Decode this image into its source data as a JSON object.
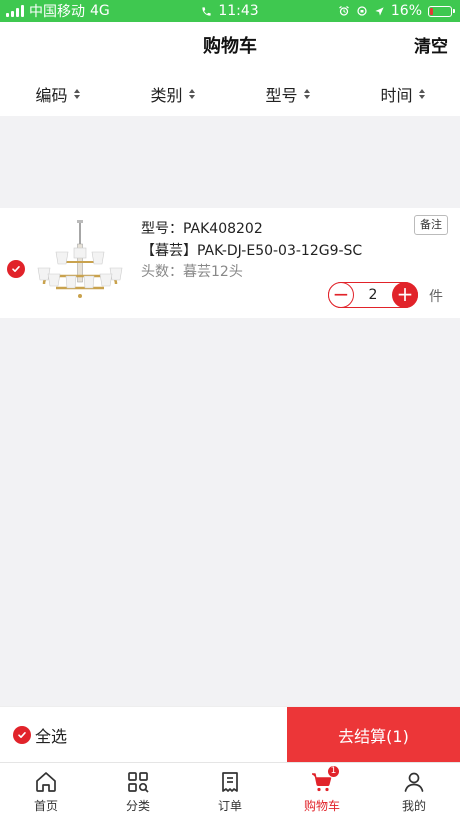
{
  "status_bar": {
    "carrier": "中国移动",
    "network": "4G",
    "time": "11:43",
    "battery": "16%",
    "battery_level": 0.16
  },
  "nav": {
    "title": "购物车",
    "clear_label": "清空"
  },
  "sort_bar": {
    "items": [
      {
        "label": "编码"
      },
      {
        "label": "类别"
      },
      {
        "label": "型号"
      },
      {
        "label": "时间"
      }
    ]
  },
  "cart": {
    "items": [
      {
        "model": "型号：PAK408202",
        "name": "【暮芸】PAK-DJ-E50-03-12G9-SC",
        "heads": "头数：暮芸12头",
        "note_label": "备注",
        "quantity": "2",
        "unit": "件",
        "checked": true
      }
    ]
  },
  "checkout": {
    "select_all_label": "全选",
    "button_label": "去结算(1)"
  },
  "tab_bar": {
    "tabs": [
      {
        "label": "首页",
        "icon": "home-icon"
      },
      {
        "label": "分类",
        "icon": "category-icon"
      },
      {
        "label": "订单",
        "icon": "order-icon"
      },
      {
        "label": "购物车",
        "icon": "cart-icon",
        "badge": "1",
        "active": true
      },
      {
        "label": "我的",
        "icon": "user-icon"
      }
    ]
  },
  "colors": {
    "status_bar": "#3fc850",
    "accent": "#e1232a",
    "checkout_button": "#ec3638"
  }
}
